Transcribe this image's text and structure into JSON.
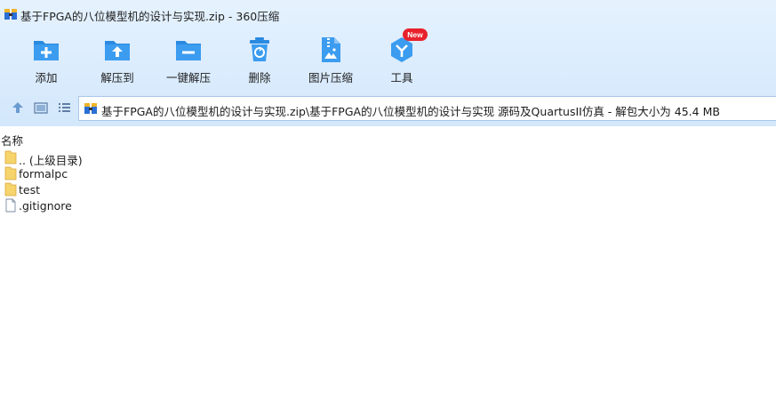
{
  "window": {
    "title": "基于FPGA的八位模型机的设计与实现.zip - 360压缩"
  },
  "toolbar": {
    "items": [
      {
        "label": "添加",
        "icon": "add-icon"
      },
      {
        "label": "解压到",
        "icon": "extract-to-icon"
      },
      {
        "label": "一键解压",
        "icon": "one-click-extract-icon"
      },
      {
        "label": "删除",
        "icon": "delete-icon"
      },
      {
        "label": "图片压缩",
        "icon": "image-compress-icon"
      },
      {
        "label": "工具",
        "icon": "tools-icon"
      }
    ],
    "badge": "New"
  },
  "address": {
    "path": "基于FPGA的八位模型机的设计与实现.zip\\基于FPGA的八位模型机的设计与实现 源码及QuartusII仿真 - 解包大小为 45.4 MB"
  },
  "list": {
    "column_name": "名称",
    "rows": [
      {
        "name": ".. (上级目录)",
        "type": "folder"
      },
      {
        "name": "formalpc",
        "type": "folder"
      },
      {
        "name": "test",
        "type": "folder"
      },
      {
        "name": ".gitignore",
        "type": "file"
      }
    ]
  },
  "colors": {
    "accent_blue": "#2a8ae0",
    "header_bg": "#dbecfd",
    "folder_yellow": "#f6d36b",
    "badge_red": "#e8222d"
  }
}
